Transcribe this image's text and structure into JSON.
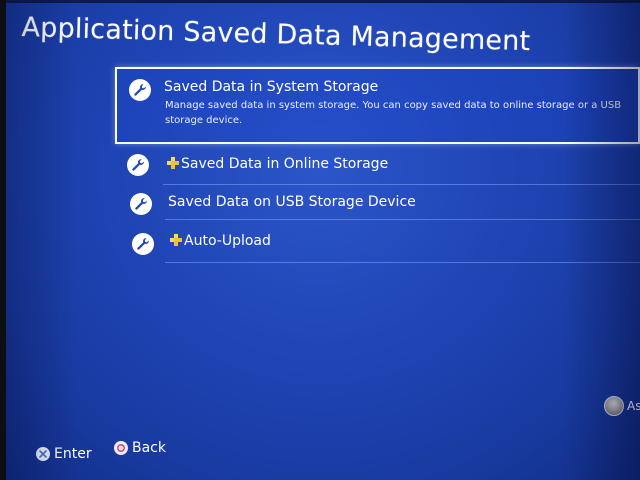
{
  "header": {
    "title": "Application Saved Data Management"
  },
  "menu": {
    "items": [
      {
        "label": "Saved Data in System Storage",
        "description": "Manage saved data in system storage. You can copy saved data to online storage or a USB storage device.",
        "icon": "wrench-icon",
        "selected": true,
        "ps_plus": false
      },
      {
        "label": "Saved Data in Online Storage",
        "icon": "wrench-icon",
        "selected": false,
        "ps_plus": true
      },
      {
        "label": "Saved Data on USB Storage Device",
        "icon": "wrench-icon",
        "selected": false,
        "ps_plus": false
      },
      {
        "label": "Auto-Upload",
        "icon": "wrench-icon",
        "selected": false,
        "ps_plus": true
      }
    ]
  },
  "footer": {
    "enter_label": "Enter",
    "enter_icon": "cross-button-icon",
    "back_label": "Back",
    "back_icon": "circle-button-icon"
  },
  "user": {
    "name": "Ash"
  },
  "colors": {
    "background": "#1f44b4",
    "ps_plus": "#f2c12e",
    "circle_button": "#e0457b",
    "cross_button": "#7fa3e0"
  }
}
